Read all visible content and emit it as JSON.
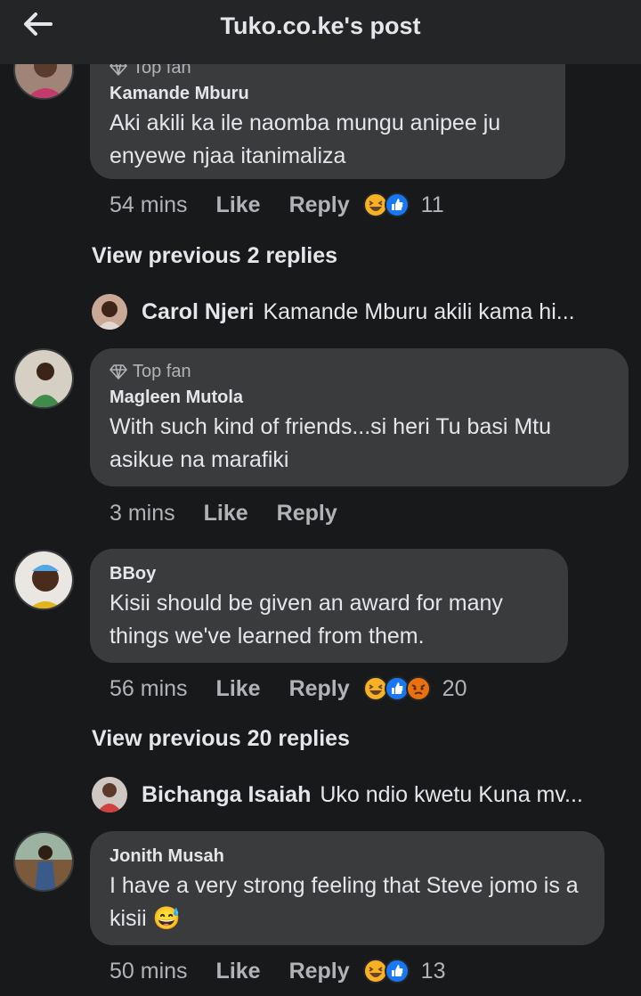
{
  "header": {
    "title": "Tuko.co.ke's post"
  },
  "comments": [
    {
      "badge": "Top fan",
      "author": "Kamande Mburu",
      "text": "Aki akili ka ile naomba mungu anipee ju enyewe njaa itanimaliza",
      "time": "54 mins",
      "like": "Like",
      "reply": "Reply",
      "reactions": [
        "haha",
        "like"
      ],
      "reaction_count": "11"
    },
    {
      "badge": "Top fan",
      "author": "Magleen Mutola",
      "text": "With such kind of friends...si heri Tu basi Mtu asikue na marafiki",
      "time": "3 mins",
      "like": "Like",
      "reply": "Reply"
    },
    {
      "author": "BBoy",
      "text": "Kisii should be given an award for many things we've learned from them.",
      "time": "56 mins",
      "like": "Like",
      "reply": "Reply",
      "reactions": [
        "haha",
        "like",
        "angry"
      ],
      "reaction_count": "20"
    },
    {
      "author": "Jonith Musah",
      "text": "I have a very strong feeling that Steve jomo is a kisii 😅",
      "time": "50 mins",
      "like": "Like",
      "reply": "Reply",
      "reactions": [
        "haha",
        "like"
      ],
      "reaction_count": "13"
    }
  ],
  "threads": [
    {
      "view_previous": "View previous 2 replies",
      "reply_preview": {
        "author": "Carol Njeri",
        "text": "Kamande Mburu akili kama hi..."
      }
    },
    {
      "view_previous": "View previous 20 replies",
      "reply_preview": {
        "author": "Bichanga Isaiah",
        "text": "Uko ndio kwetu Kuna mv..."
      }
    }
  ],
  "colors": {
    "background": "#18191a",
    "bubble": "#3a3b3c",
    "like_blue": "#1877f2",
    "haha_yellow": "#f7b125",
    "angry_orange": "#e9710f"
  }
}
